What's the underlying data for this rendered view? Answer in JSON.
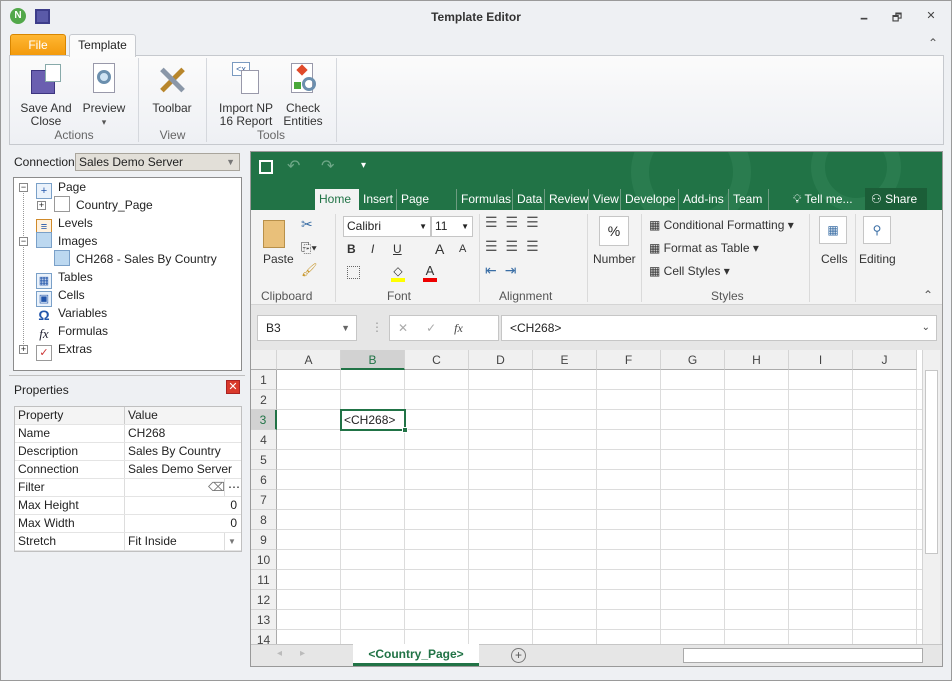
{
  "window": {
    "title": "Template Editor",
    "app_icon": "N",
    "minimize": "🗕",
    "restore": "🗗",
    "close": "✕"
  },
  "tabs": {
    "file": "File",
    "template": "Template",
    "collapse": "⌃"
  },
  "ribbon": {
    "buttons": [
      {
        "label": "Save And\nClose",
        "icon": "save-and-close-icon"
      },
      {
        "label": "Preview",
        "icon": "preview-icon",
        "dropdown": "▾"
      },
      {
        "label": "Toolbar",
        "icon": "toolbar-icon"
      },
      {
        "label": "Import NP\n16 Report",
        "icon": "import-icon"
      },
      {
        "label": "Check\nEntities",
        "icon": "check-entities-icon"
      }
    ],
    "groups": [
      "Actions",
      "View",
      "Tools"
    ]
  },
  "left": {
    "connection_label": "Connection",
    "connection_value": "Sales Demo Server",
    "tree": [
      "Page",
      "Country_Page",
      "Levels",
      "Images",
      "CH268 - Sales By Country",
      "Tables",
      "Cells",
      "Variables",
      "Formulas",
      "Extras"
    ],
    "properties_title": "Properties",
    "grid_headers": [
      "Property",
      "Value"
    ],
    "rows": [
      [
        "Name",
        "CH268"
      ],
      [
        "Description",
        "Sales By Country"
      ],
      [
        "Connection",
        "Sales Demo Server"
      ],
      [
        "Filter",
        ""
      ],
      [
        "Max Height",
        "0"
      ],
      [
        "Max Width",
        "0"
      ],
      [
        "Stretch",
        "Fit Inside"
      ]
    ]
  },
  "excel": {
    "tabs": [
      "Home",
      "Insert",
      "Page Layo",
      "Formulas",
      "Data",
      "Review",
      "View",
      "Develope",
      "Add-ins",
      "Team"
    ],
    "tell_me": "Tell me...",
    "share": "Share",
    "clipboard": {
      "paste": "Paste",
      "group": "Clipboard"
    },
    "font": {
      "name": "Calibri",
      "size": "11",
      "group": "Font",
      "bold": "B",
      "italic": "I",
      "underline": "U",
      "grow": "A",
      "shrink": "A"
    },
    "alignment_group": "Alignment",
    "number": {
      "label": "Number",
      "symbol": "%"
    },
    "styles": {
      "conditional": "Conditional Formatting",
      "table": "Format as Table",
      "cell": "Cell Styles",
      "group": "Styles"
    },
    "cells": "Cells",
    "editing": "Editing",
    "name_box": "B3",
    "fx": "fx",
    "formula": "<CH268>",
    "columns": [
      "A",
      "B",
      "C",
      "D",
      "E",
      "F",
      "G",
      "H",
      "I",
      "J"
    ],
    "rows": [
      "1",
      "2",
      "3",
      "4",
      "5",
      "6",
      "7",
      "8",
      "9",
      "10",
      "11",
      "12",
      "13",
      "14"
    ],
    "active_cell_value": "<CH268>",
    "sheet_tab": "<Country_Page>",
    "accent": "#217346"
  }
}
